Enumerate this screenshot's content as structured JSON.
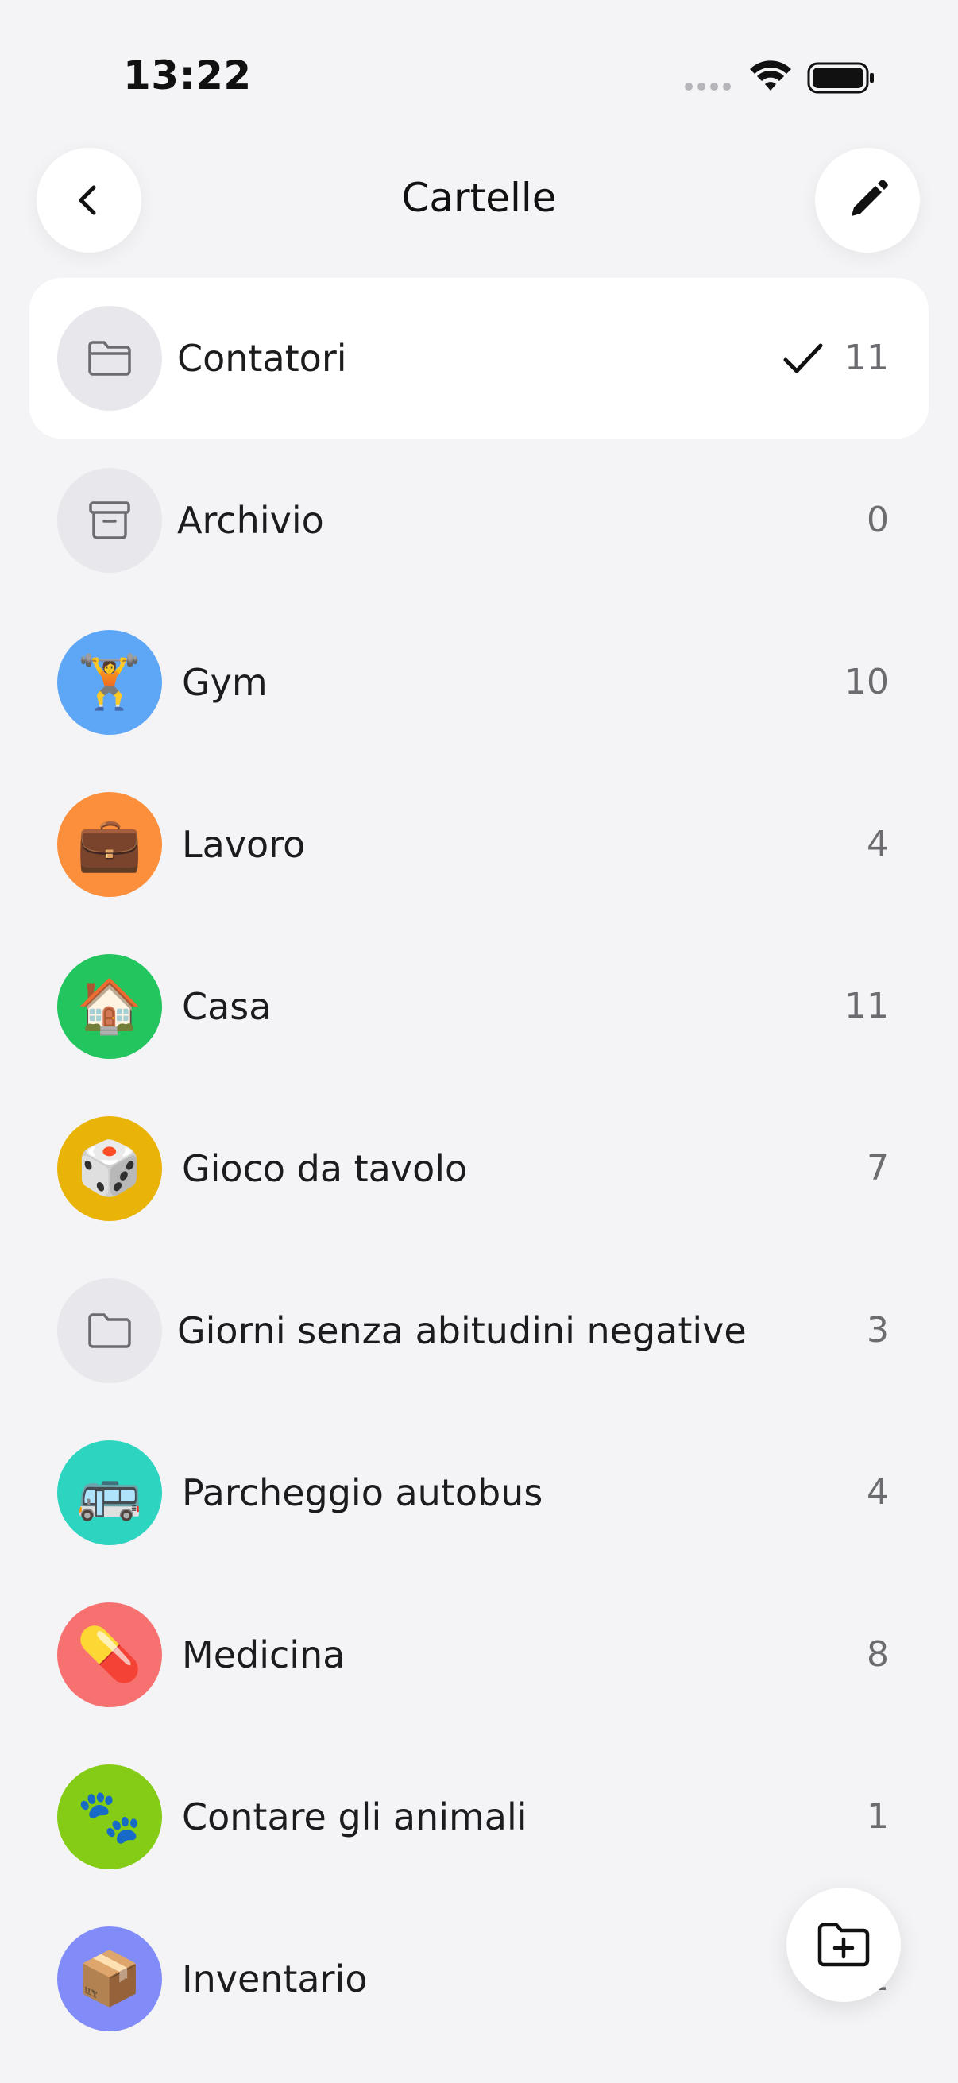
{
  "status_bar": {
    "time": "13:22"
  },
  "nav": {
    "title": "Cartelle"
  },
  "folders": [
    {
      "label": "Contatori",
      "count": "11",
      "selected": true,
      "icon": "folder-icon",
      "color": "#e7e7ec"
    },
    {
      "label": "Archivio",
      "count": "0",
      "selected": false,
      "icon": "archive-icon",
      "color": "#e7e7ec"
    },
    {
      "label": "Gym",
      "count": "10",
      "selected": false,
      "icon": "🏋️",
      "color": "#5ea7f7"
    },
    {
      "label": "Lavoro",
      "count": "4",
      "selected": false,
      "icon": "💼",
      "color": "#fb8f3c"
    },
    {
      "label": "Casa",
      "count": "11",
      "selected": false,
      "icon": "🏠",
      "color": "#22c55e"
    },
    {
      "label": "Gioco da tavolo",
      "count": "7",
      "selected": false,
      "icon": "🎲",
      "color": "#eab308"
    },
    {
      "label": "Giorni senza abitudini negative",
      "count": "3",
      "selected": false,
      "icon": "folder-icon",
      "color": "#e7e7ec"
    },
    {
      "label": "Parcheggio autobus",
      "count": "4",
      "selected": false,
      "icon": "🚌",
      "color": "#2dd4bf"
    },
    {
      "label": "Medicina",
      "count": "8",
      "selected": false,
      "icon": "💊",
      "color": "#f87171"
    },
    {
      "label": "Contare gli animali",
      "count": "1",
      "selected": false,
      "icon": "🐾",
      "color": "#84cc16"
    },
    {
      "label": "Inventario",
      "count": "1",
      "selected": false,
      "icon": "📦",
      "color": "#818cf8"
    }
  ],
  "icons": {
    "back": "chevron-left-icon",
    "edit": "pencil-icon",
    "check": "checkmark-icon",
    "fab": "folder-plus-icon"
  }
}
